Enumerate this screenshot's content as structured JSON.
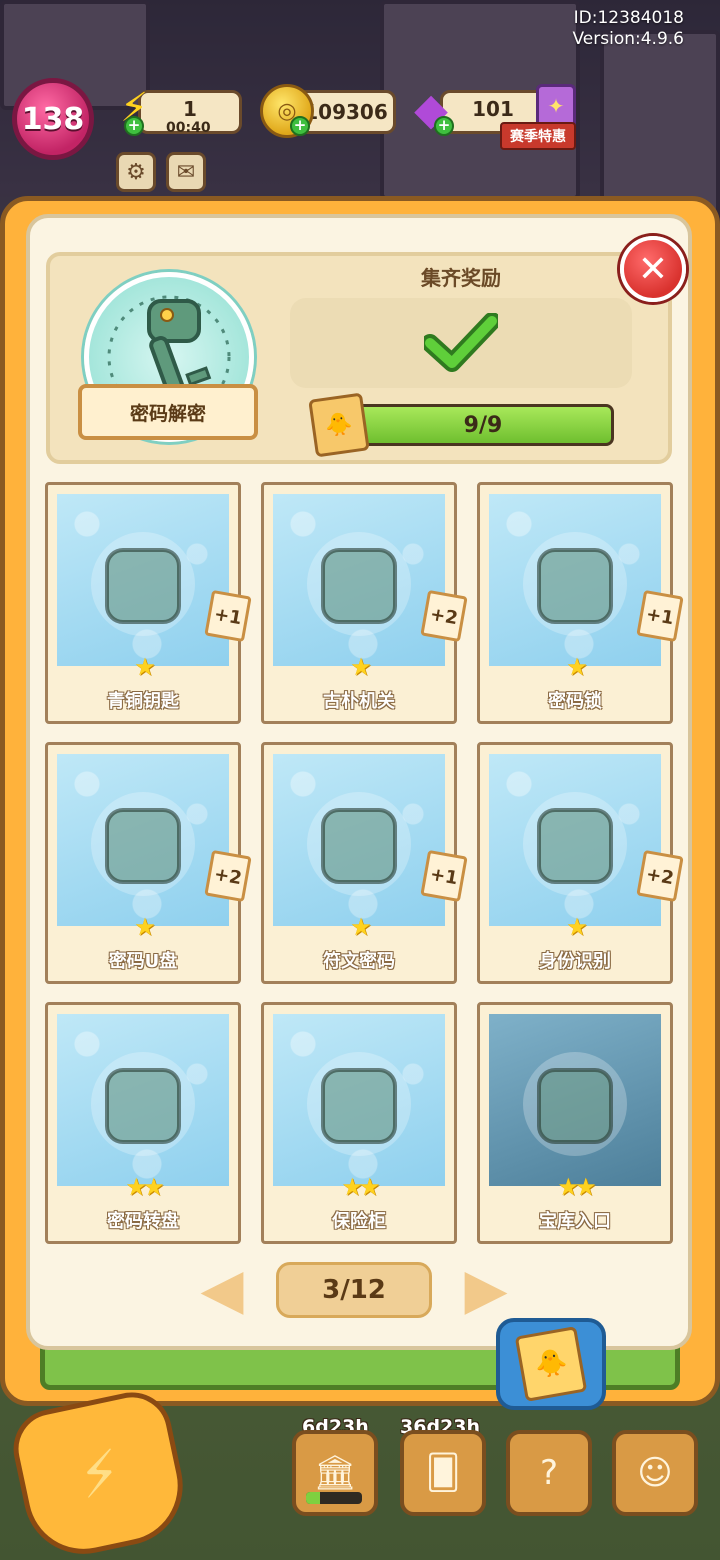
{
  "meta": {
    "id_label": "ID:12384018",
    "version_label": "Version:4.9.6"
  },
  "hud": {
    "level": "138",
    "energy_value": "1",
    "energy_timer": "00:40",
    "coins_value": "109306",
    "gems_value": "101",
    "season_label": "赛季特惠",
    "icons": [
      "settings-gear-icon",
      "mail-icon",
      "lightning-icon",
      "coin-icon",
      "gem-icon"
    ]
  },
  "album": {
    "set_name": "密码解密",
    "reward_title": "集齐奖励",
    "reward_status": "completed",
    "progress_text": "9/9",
    "progress_fraction": 1.0,
    "page_text": "3/12",
    "colors": {
      "accent": "#ffb23b",
      "progress": "#8fd84a",
      "close": "#d9322e"
    }
  },
  "cards": [
    {
      "name": "青铜钥匙",
      "stars": "★",
      "dup": "+1",
      "art": "bronze-key"
    },
    {
      "name": "古朴机关",
      "stars": "★",
      "dup": "+2",
      "art": "ancient-mechanism"
    },
    {
      "name": "密码锁",
      "stars": "★",
      "dup": "+1",
      "art": "padlock"
    },
    {
      "name": "密码U盘",
      "stars": "★",
      "dup": "+2",
      "art": "usb-drive"
    },
    {
      "name": "符文密码",
      "stars": "★",
      "dup": "+1",
      "art": "rune-clipboard"
    },
    {
      "name": "身份识别",
      "stars": "★",
      "dup": "+2",
      "art": "id-scanner"
    },
    {
      "name": "密码转盘",
      "stars": "★★",
      "dup": "",
      "art": "cipher-wheel"
    },
    {
      "name": "保险柜",
      "stars": "★★",
      "dup": "",
      "art": "safe"
    },
    {
      "name": "宝库入口",
      "stars": "★★",
      "dup": "",
      "art": "vault-door"
    }
  ],
  "dock": {
    "timer_1": "6d23h",
    "timer_2": "36d23h",
    "bar_fraction": 0.25
  }
}
